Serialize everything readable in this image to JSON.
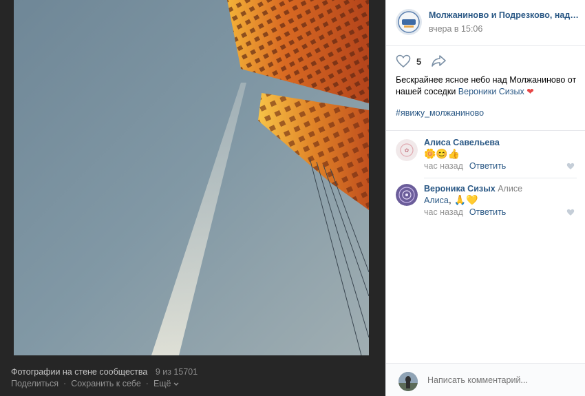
{
  "viewer": {
    "footer_title": "Фотографии на стене сообщества",
    "counter": "9 из 15701",
    "share": "Поделиться",
    "save": "Сохранить к себе",
    "more": "Ещё"
  },
  "post": {
    "group_name": "Молжаниново и Подрезково, наде...",
    "time": "вчера в 15:06",
    "like_count": "5",
    "text_main": "Бескрайнее ясное небо над Молжаниново от нашей соседки ",
    "text_link": "Вероники Сизых",
    "text_emoji": "❤",
    "hashtag": "#явижу_молжаниново"
  },
  "comments": [
    {
      "author": "Алиса Савельева",
      "reply_to": "",
      "text_emoji": "🌼😊👍",
      "time": "час назад",
      "reply_label": "Ответить"
    },
    {
      "author": "Вероника Сизых",
      "reply_to": "Алисе",
      "text_link": "Алиса",
      "text_emoji": ", 🙏💛",
      "time": "час назад",
      "reply_label": "Ответить"
    }
  ],
  "composer": {
    "placeholder": "Написать комментарий..."
  },
  "colors": {
    "link": "#2a5885",
    "viewer_bg": "#262626",
    "sky": "#7d93a1",
    "building": "#c9521f"
  }
}
